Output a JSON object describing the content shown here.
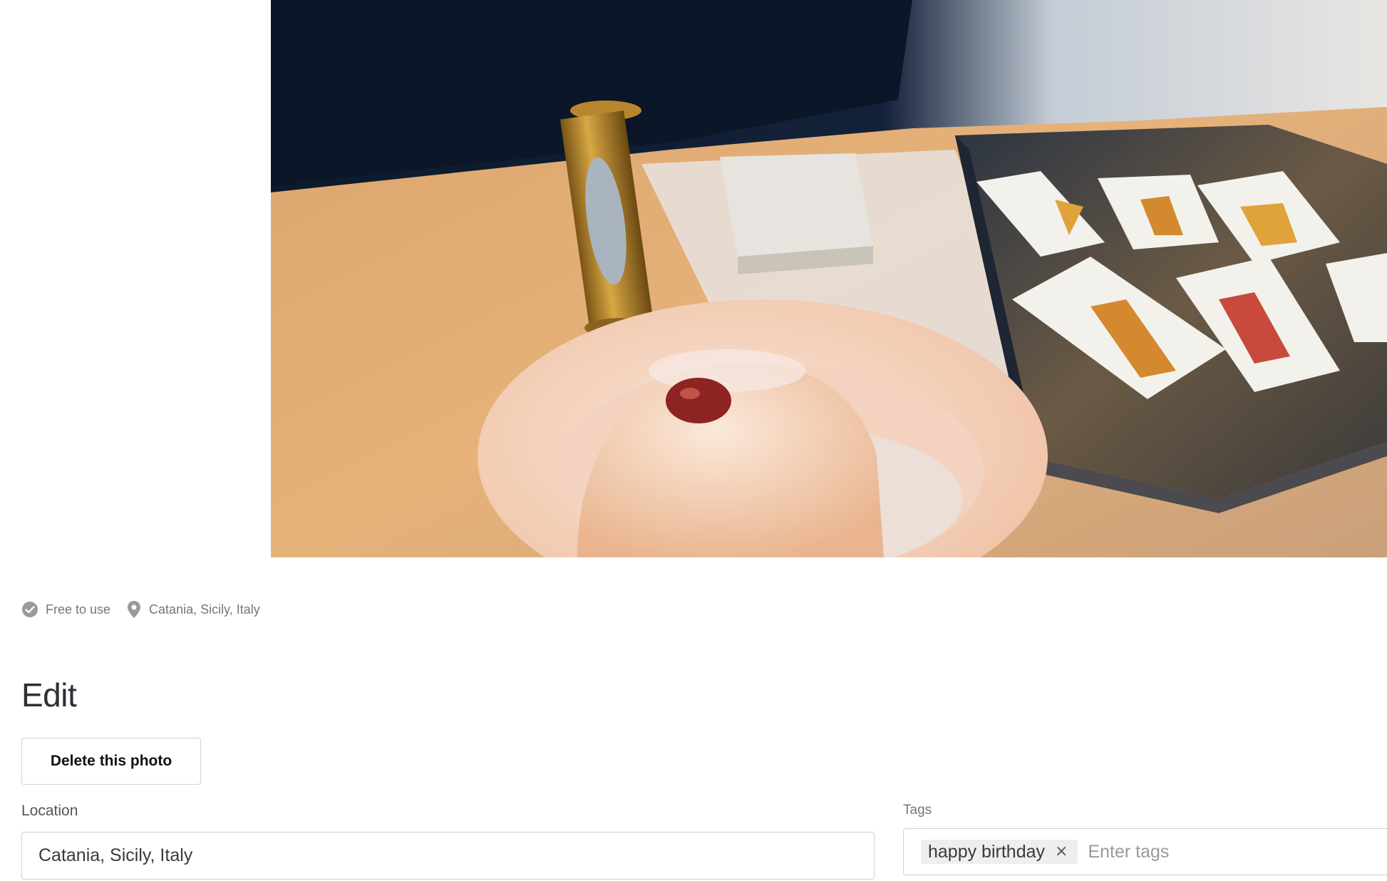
{
  "photo": {
    "description_icon": "photo-image"
  },
  "meta": {
    "license_icon": "check-circle-icon",
    "license_label": "Free to use",
    "location_icon": "map-pin-icon",
    "location_label": "Catania, Sicily, Italy"
  },
  "edit": {
    "title": "Edit",
    "delete_label": "Delete this photo",
    "location_label": "Location",
    "location_value": "Catania, Sicily, Italy",
    "tags_label": "Tags",
    "tags": [
      {
        "label": "happy birthday"
      }
    ],
    "tag_remove_glyph": "×",
    "tags_placeholder": "Enter tags"
  },
  "colors": {
    "muted_text": "#767676",
    "border": "#d1d1d1",
    "chip_bg": "#eeeeee",
    "title": "#2c2f36"
  }
}
